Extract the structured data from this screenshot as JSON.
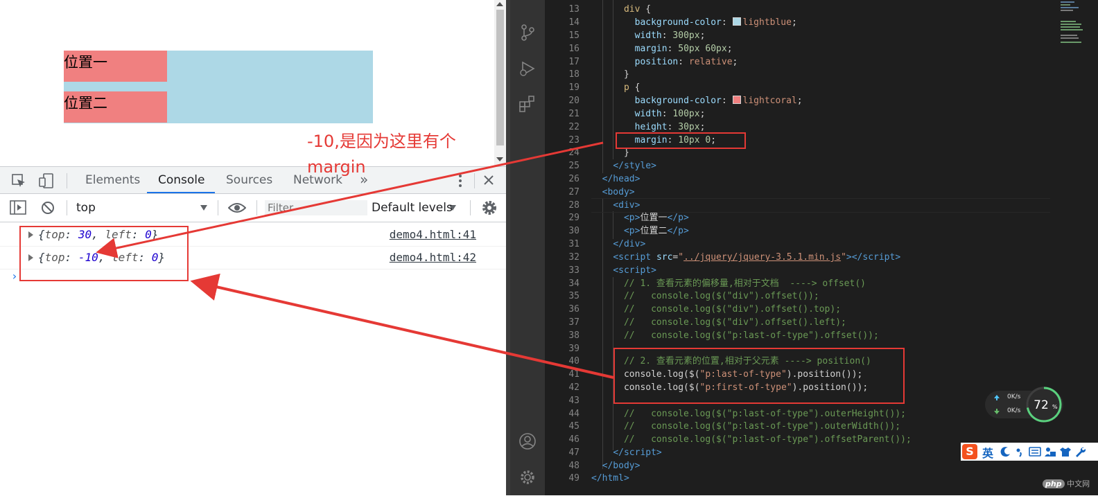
{
  "preview": {
    "p1": "位置一",
    "p2": "位置二"
  },
  "devtools": {
    "tabs": [
      "Elements",
      "Console",
      "Sources",
      "Network"
    ],
    "more_tabs": "»",
    "context": "top",
    "filter_placeholder": "Filter",
    "levels": "Default levels",
    "logs": [
      {
        "top_key": "top",
        "top_val": "30",
        "left_key": "left",
        "left_val": "0",
        "source": "demo4.html:41"
      },
      {
        "top_key": "top",
        "top_val": "-10",
        "left_key": "left",
        "left_val": "0",
        "source": "demo4.html:42"
      }
    ],
    "prompt": "›"
  },
  "annotation": {
    "text": "-10,是因为这里有个margin"
  },
  "editor": {
    "line_numbers": [
      "13",
      "14",
      "15",
      "16",
      "17",
      "18",
      "19",
      "20",
      "21",
      "22",
      "23",
      "24",
      "25",
      "26",
      "27",
      "28",
      "29",
      "30",
      "31",
      "32",
      "33",
      "34",
      "35",
      "36",
      "37",
      "38",
      "39",
      "40",
      "41",
      "42",
      "43",
      "44",
      "45",
      "46",
      "47",
      "48",
      "49"
    ],
    "swatch_colors": {
      "lightblue": "#add8e6",
      "lightcoral": "#f08080"
    }
  },
  "netwidget": {
    "up": "0K/s",
    "down": "0K/s",
    "percent": "72",
    "percent_suffix": "%"
  },
  "ime": {
    "lang": "英"
  },
  "watermark": {
    "brand": "php",
    "site": "中文网"
  }
}
